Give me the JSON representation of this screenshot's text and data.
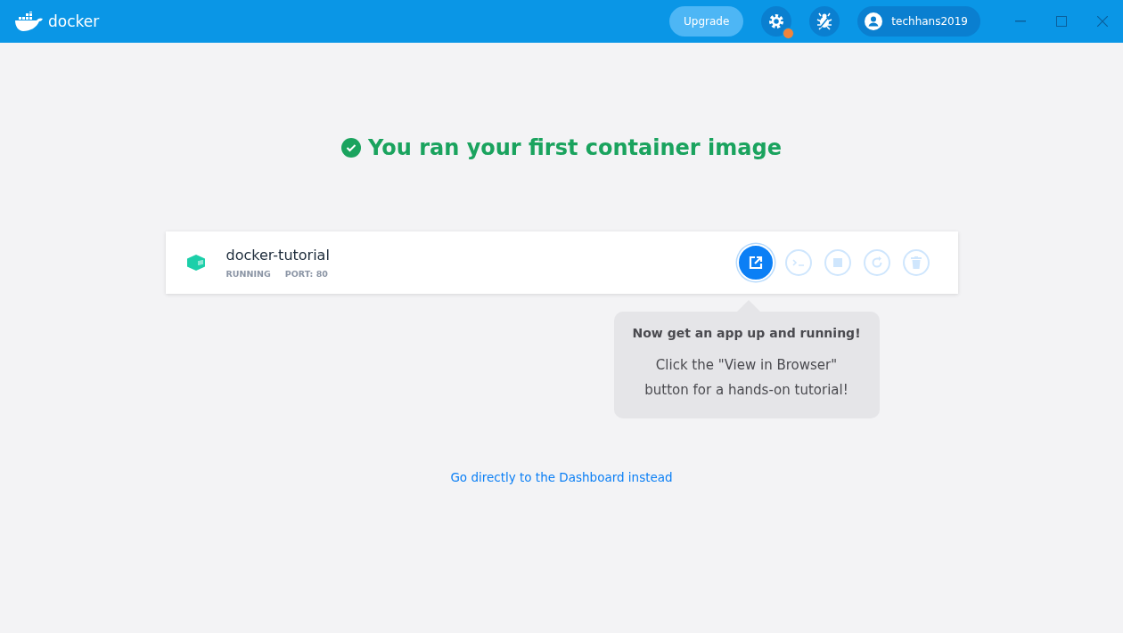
{
  "header": {
    "logo": "docker",
    "upgrade": "Upgrade",
    "user": "techhans2019",
    "settings_alert": true
  },
  "title": "You ran your first container image",
  "container": {
    "name": "docker-tutorial",
    "status": "RUNNING",
    "port": "PORT: 80",
    "actions": [
      {
        "kind": "browser",
        "highlighted": true
      },
      {
        "kind": "cli",
        "highlighted": false
      },
      {
        "kind": "stop",
        "highlighted": false
      },
      {
        "kind": "restart",
        "highlighted": false
      },
      {
        "kind": "delete",
        "highlighted": false
      }
    ]
  },
  "tooltip": {
    "heading": "Now get an app up and running!",
    "body": "Click the \"View in Browser\" button for a hands-on tutorial!"
  },
  "link": "Go directly to the Dashboard instead"
}
